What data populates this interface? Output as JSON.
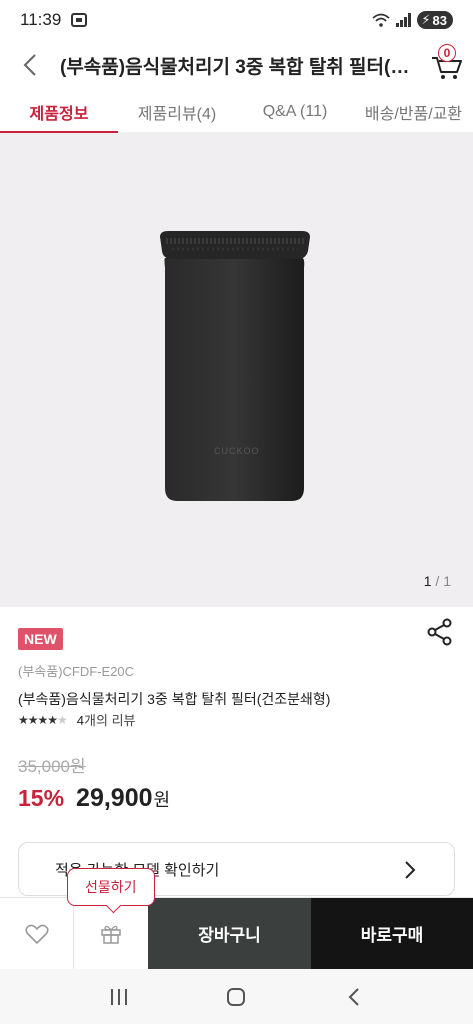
{
  "status": {
    "time": "11:39",
    "battery": "83"
  },
  "header": {
    "title": "(부속품)음식물처리기 3중 복합 탈취 필터(건조분쇄형)",
    "cart_count": "0"
  },
  "tabs": [
    {
      "label": "제품정보",
      "active": true
    },
    {
      "label": "제품리뷰(4)"
    },
    {
      "label": "Q&A (11)"
    },
    {
      "label": "배송/반품/교환"
    }
  ],
  "gallery": {
    "current": "1",
    "separator": "/",
    "total": "1",
    "product_logo": "CUCKOO"
  },
  "product": {
    "badge": "NEW",
    "model": "(부속품)CFDF-E20C",
    "name": "(부속품)음식물처리기 3중 복합 탈취 필터(건조분쇄형)",
    "rating": 4,
    "review_count": "4",
    "review_suffix": "개의 리뷰",
    "original_price": "35,000원",
    "discount": "15%",
    "price": "29,900",
    "currency": "원"
  },
  "compat_button": {
    "label": "적용 가능한 모델 확인하기"
  },
  "gift_tooltip": "선물하기",
  "bottom_bar": {
    "cart_label": "장바구니",
    "buy_label": "바로구매"
  },
  "colors": {
    "accent": "#c8233b",
    "dark": "#141414",
    "cart_bg": "#3b3f3d",
    "badge": "#e0526a"
  },
  "icons": [
    "back-arrow-icon",
    "cart-icon",
    "share-icon",
    "chevron-right-icon",
    "heart-icon",
    "gift-icon",
    "recents-icon",
    "home-icon",
    "nav-back-icon"
  ]
}
